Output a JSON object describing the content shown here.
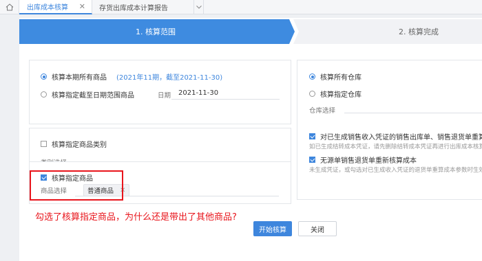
{
  "tabs": [
    {
      "label": "出库成本核算",
      "active": true
    },
    {
      "label": "存货出库成本计算报告",
      "active": false
    }
  ],
  "steps": [
    {
      "label": "1. 核算范围",
      "active": true
    },
    {
      "label": "2. 核算完成",
      "active": false
    }
  ],
  "scope": {
    "all_goods_label": "核算本期所有商品",
    "all_goods_note_prefix": "(2021年11期，截至",
    "all_goods_note_date": "2021-11-30",
    "all_goods_note_suffix": ")",
    "range_goods_label": "核算指定截至日期范围商品",
    "date_label": "日期",
    "date_value": "2021-11-30"
  },
  "category": {
    "label": "核算指定商品类别",
    "select_label": "类别选择"
  },
  "goods": {
    "label": "核算指定商品",
    "select_label": "商品选择",
    "selected_tag": "普通商品",
    "checked": true
  },
  "warehouse": {
    "all_label": "核算所有仓库",
    "specific_label": "核算指定仓库",
    "select_label": "仓库选择"
  },
  "options": [
    {
      "label": "对已生成销售收入凭证的销售出库单、销售退货单重算成本",
      "hint": "如已生成结转成本凭证，请先删除结转成本凭证再进行出库成本核算",
      "checked": true
    },
    {
      "label": "无源单销售退货单重新核算成本",
      "hint": "未生成凭证，或勾选对已生成收入凭证的退货单重算成本参数时生效",
      "checked": true
    }
  ],
  "annotation": "勾选了核算指定商品，为什么还是带出了其他商品?",
  "buttons": {
    "start": "开始核算",
    "close": "关闭"
  },
  "colors": {
    "accent": "#3e86dd",
    "annotation": "#e8141b"
  }
}
